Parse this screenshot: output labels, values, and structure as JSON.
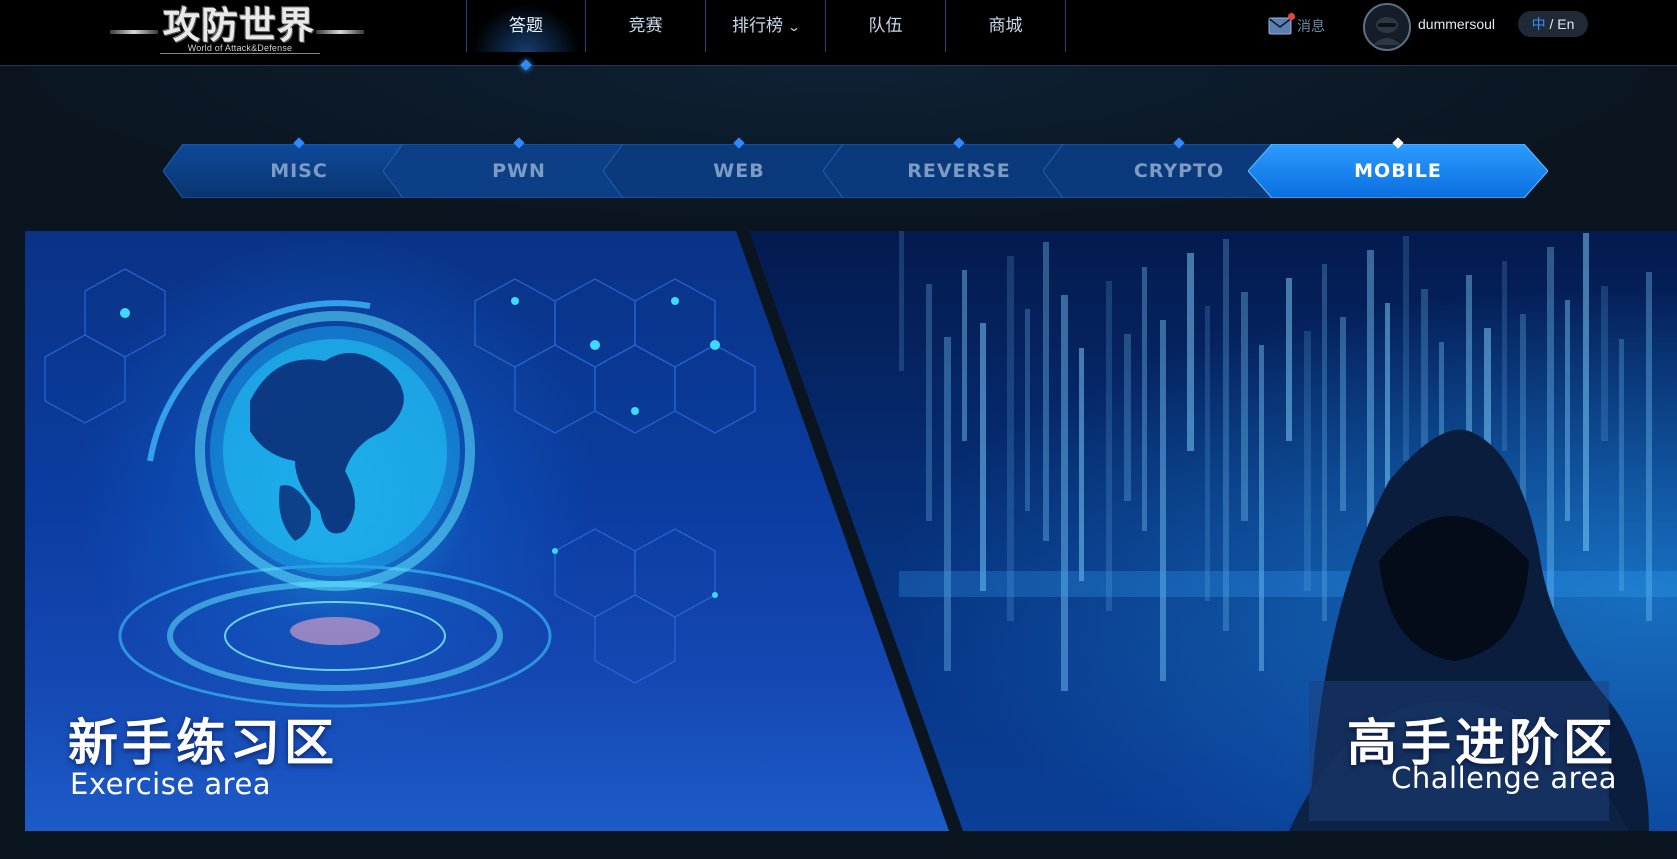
{
  "logo": {
    "title": "攻防世界",
    "subtitle": "World of Attack&Defense"
  },
  "nav": {
    "items": [
      {
        "label": "答题",
        "active": true
      },
      {
        "label": "竞赛"
      },
      {
        "label": "排行榜",
        "has_dropdown": true
      },
      {
        "label": "队伍"
      },
      {
        "label": "商城"
      }
    ]
  },
  "header": {
    "messages_label": "消息",
    "username": "dummersoul",
    "lang_zh": "中",
    "lang_sep": " / ",
    "lang_en": "En"
  },
  "categories": {
    "items": [
      {
        "label": "MISC"
      },
      {
        "label": "PWN"
      },
      {
        "label": "WEB"
      },
      {
        "label": "REVERSE"
      },
      {
        "label": "CRYPTO"
      },
      {
        "label": "MOBILE",
        "active": true
      }
    ]
  },
  "areas": {
    "exercise": {
      "title": "新手练习区",
      "subtitle": "Exercise area"
    },
    "challenge": {
      "title": "高手进阶区",
      "subtitle": "Challenge area"
    }
  },
  "colors": {
    "accent": "#2d8cff",
    "active_tab": "#1a8cff",
    "navbar_bg": "#000000",
    "page_bg": "#0a1520"
  },
  "icons": [
    "mail-icon",
    "chevron-down-icon",
    "user-avatar-icon"
  ]
}
